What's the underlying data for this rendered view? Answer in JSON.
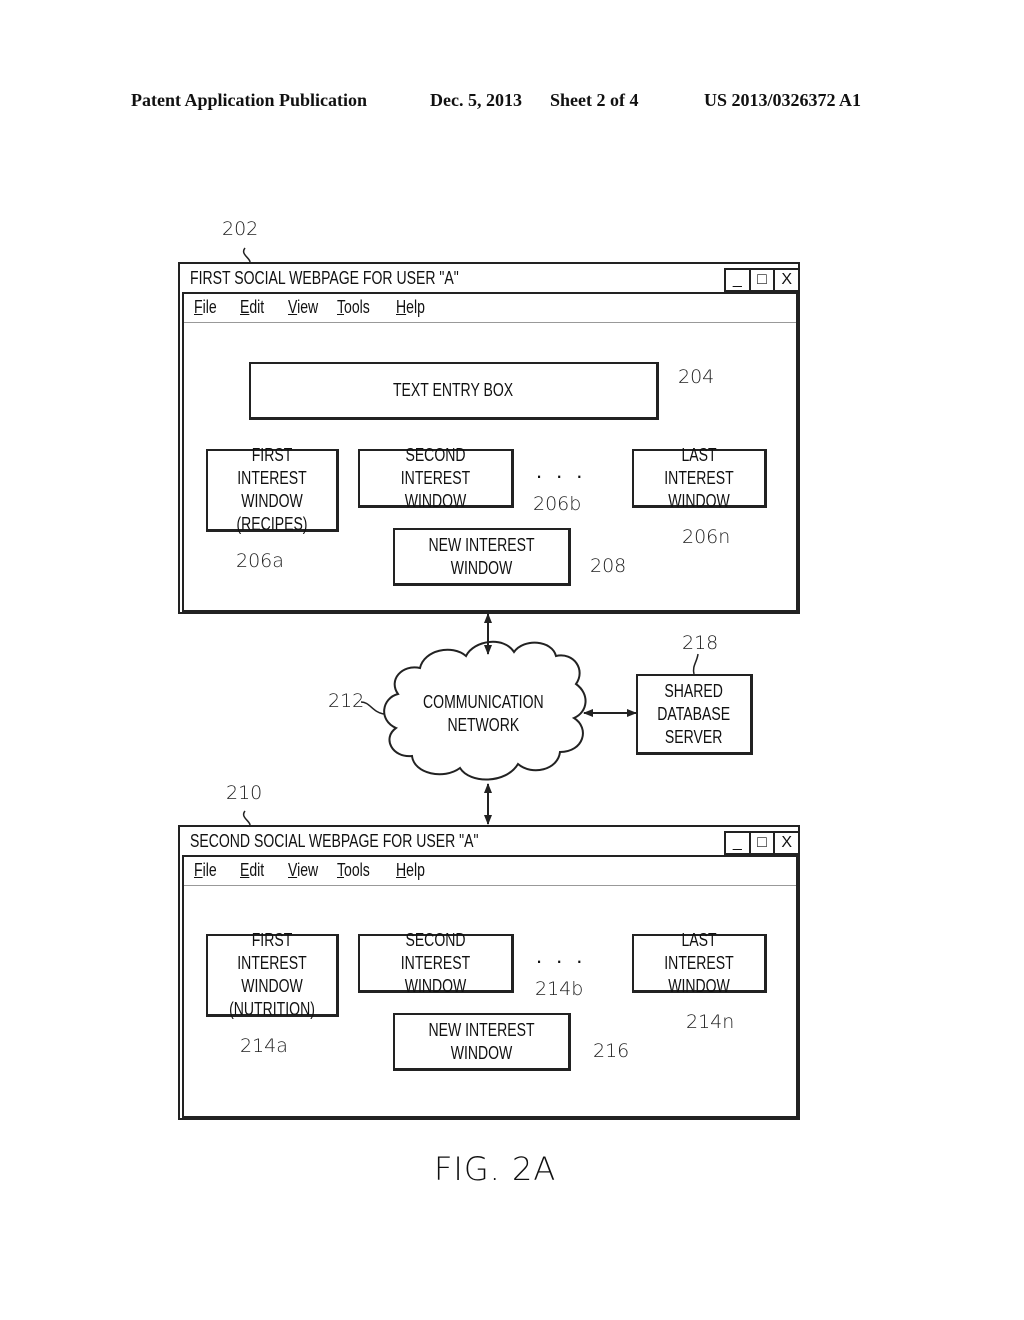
{
  "header": {
    "publication": "Patent Application Publication",
    "date": "Dec. 5, 2013",
    "sheet": "Sheet 2 of 4",
    "number": "US 2013/0326372 A1"
  },
  "window1": {
    "ref": "202",
    "title": "FIRST SOCIAL WEBPAGE FOR USER \"A\"",
    "controls": {
      "minimize": "_",
      "maximize": "□",
      "close": "X"
    },
    "menu": [
      {
        "key": "F",
        "rest": "ile"
      },
      {
        "key": "E",
        "rest": "dit"
      },
      {
        "key": "V",
        "rest": "iew"
      },
      {
        "key": "T",
        "rest": "ools"
      },
      {
        "key": "H",
        "rest": "elp"
      }
    ],
    "text_entry": {
      "label": "TEXT ENTRY BOX",
      "ref": "204"
    },
    "interests": [
      {
        "label": "FIRST INTEREST\nWINDOW\n(RECIPES)",
        "ref": "206a"
      },
      {
        "label": "SECOND INTEREST\nWINDOW",
        "ref": "206b"
      },
      {
        "label": "LAST INTEREST\nWINDOW",
        "ref": "206n"
      }
    ],
    "ellipsis": "...",
    "new_interest": {
      "label": "NEW INTEREST WINDOW",
      "ref": "208"
    }
  },
  "network": {
    "label": "COMMUNICATION\nNETWORK",
    "ref": "212"
  },
  "server": {
    "label": "SHARED\nDATABASE\nSERVER",
    "ref": "218"
  },
  "window2": {
    "ref": "210",
    "title": "SECOND SOCIAL WEBPAGE FOR USER \"A\"",
    "controls": {
      "minimize": "_",
      "maximize": "□",
      "close": "X"
    },
    "menu": [
      {
        "key": "F",
        "rest": "ile"
      },
      {
        "key": "E",
        "rest": "dit"
      },
      {
        "key": "V",
        "rest": "iew"
      },
      {
        "key": "T",
        "rest": "ools"
      },
      {
        "key": "H",
        "rest": "elp"
      }
    ],
    "interests": [
      {
        "label": "FIRST INTEREST\nWINDOW\n(NUTRITION)",
        "ref": "214a"
      },
      {
        "label": "SECOND INTEREST\nWINDOW",
        "ref": "214b"
      },
      {
        "label": "LAST INTEREST\nWINDOW",
        "ref": "214n"
      }
    ],
    "ellipsis": "...",
    "new_interest": {
      "label": "NEW INTEREST WINDOW",
      "ref": "216"
    }
  },
  "figure_label": "FIG. 2A"
}
